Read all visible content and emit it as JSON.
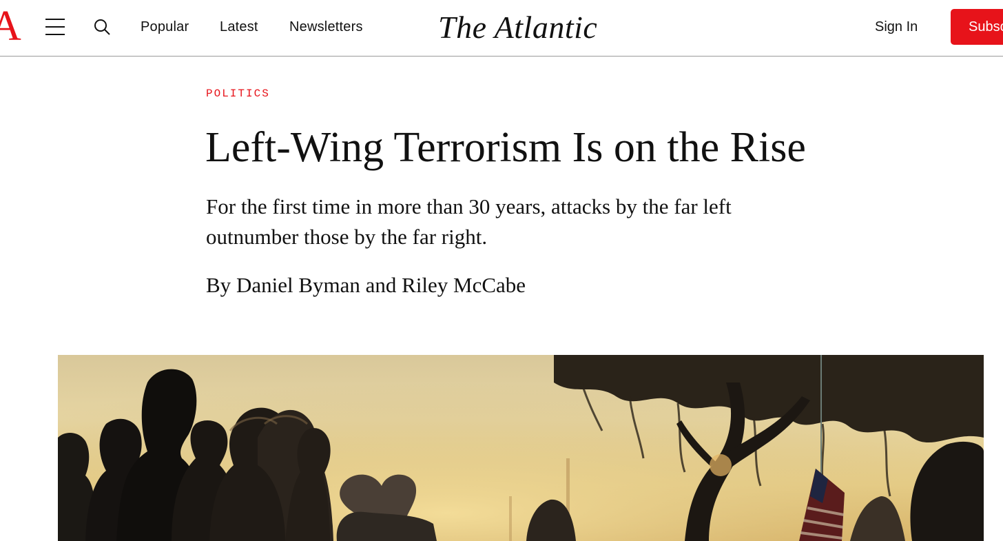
{
  "header": {
    "logo_letter": "A",
    "nav": {
      "popular": "Popular",
      "latest": "Latest",
      "newsletters": "Newsletters"
    },
    "masthead": "The Atlantic",
    "sign_in": "Sign In",
    "subscribe": "Subscribe",
    "icons": [
      "menu-icon",
      "search-icon"
    ]
  },
  "article": {
    "section": "POLITICS",
    "headline": "Left-Wing Terrorism Is on the Rise",
    "dek": "For the first time in more than 30 years, attacks by the far left outnumber those by the far right.",
    "byline_prefix": "By",
    "authors": [
      "Daniel Byman",
      "Riley McCabe"
    ],
    "byline_joiner": "and"
  },
  "colors": {
    "brand_red": "#e7131a",
    "text": "#111111",
    "divider": "#9a9a9a"
  }
}
